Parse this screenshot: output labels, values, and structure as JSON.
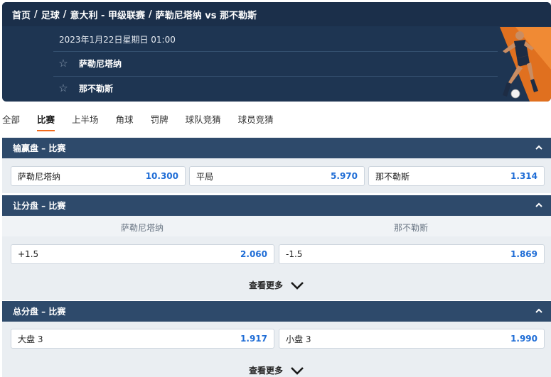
{
  "breadcrumb": {
    "items": [
      "首页",
      "足球",
      "意大利 - 甲级联赛",
      "萨勒尼塔纳 vs 那不勒斯"
    ],
    "separator": "/"
  },
  "match": {
    "datetime": "2023年1月22日星期日 01:00",
    "home_team": "萨勒尼塔纳",
    "away_team": "那不勒斯",
    "favorite_icon": "star-icon"
  },
  "tabs": [
    {
      "label": "全部",
      "active": false
    },
    {
      "label": "比赛",
      "active": true
    },
    {
      "label": "上半场",
      "active": false
    },
    {
      "label": "角球",
      "active": false
    },
    {
      "label": "罚牌",
      "active": false
    },
    {
      "label": "球队竞猜",
      "active": false
    },
    {
      "label": "球员竞猜",
      "active": false
    }
  ],
  "markets": {
    "moneyline": {
      "title": "输赢盘 – 比赛",
      "options": [
        {
          "label": "萨勒尼塔纳",
          "odds": "10.300"
        },
        {
          "label": "平局",
          "odds": "5.970"
        },
        {
          "label": "那不勒斯",
          "odds": "1.314"
        }
      ]
    },
    "handicap": {
      "title": "让分盘 – 比赛",
      "columns": [
        "萨勒尼塔纳",
        "那不勒斯"
      ],
      "options": [
        {
          "label": "+1.5",
          "odds": "2.060"
        },
        {
          "label": "-1.5",
          "odds": "1.869"
        }
      ],
      "more_label": "查看更多"
    },
    "totals": {
      "title": "总分盘 – 比赛",
      "options": [
        {
          "label": "大盘 3",
          "odds": "1.917"
        },
        {
          "label": "小盘 3",
          "odds": "1.990"
        }
      ],
      "more_label": "查看更多"
    }
  },
  "colors": {
    "header_bg": "#1e3552",
    "section_bg": "#2e4a6b",
    "odds_blue": "#1f6dd6",
    "tab_underline": "#f26b1d"
  }
}
